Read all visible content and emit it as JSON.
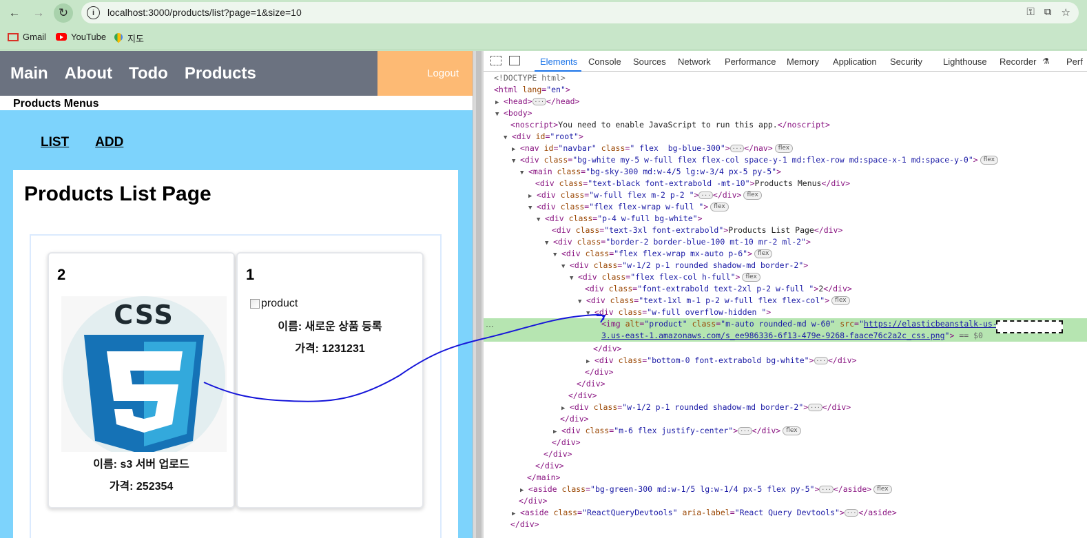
{
  "browser": {
    "url": "localhost:3000/products/list?page=1&size=10",
    "back_glyph": "←",
    "forward_glyph": "→",
    "reload_glyph": "↻",
    "bookmarks": [
      {
        "label": "Gmail",
        "icon": "gmail-icon"
      },
      {
        "label": "YouTube",
        "icon": "youtube-icon"
      },
      {
        "label": "지도",
        "icon": "maps-icon"
      }
    ]
  },
  "page": {
    "nav": [
      "Main",
      "About",
      "Todo",
      "Products"
    ],
    "logout": "Logout",
    "products_menus": "Products Menus",
    "sub_nav": {
      "list": "LIST",
      "add": "ADD"
    },
    "list_title": "Products List Page",
    "cards": [
      {
        "num": "2",
        "name": "이름: s3 서버 업로드",
        "price": "가격: 252354",
        "image": "css3-logo"
      },
      {
        "num": "1",
        "broken_alt": "product",
        "name": "이름: 새로운 상품 등록",
        "price": "가격: 1231231"
      }
    ]
  },
  "devtools": {
    "tabs": [
      "Elements",
      "Console",
      "Sources",
      "Network",
      "Performance",
      "Memory",
      "Application",
      "Security",
      "Lighthouse",
      "Recorder",
      "Perf"
    ],
    "active_tab": "Elements",
    "badge": "flex",
    "eq_sel": "== $0",
    "lines": {
      "l1": "<!DOCTYPE html>",
      "l_noscript_text": "You need to enable JavaScript to run this app.",
      "l_products_menus": "Products Menus",
      "l_title": "Products List Page",
      "l_num": "2",
      "img_src_1": "https://elasticbeanstalk-us-east",
      "img_src_2": "3.us-east-1.amazonaws.com/s_ee986336-6f13-479e-9268-faace76c2a2c_css.png"
    }
  }
}
